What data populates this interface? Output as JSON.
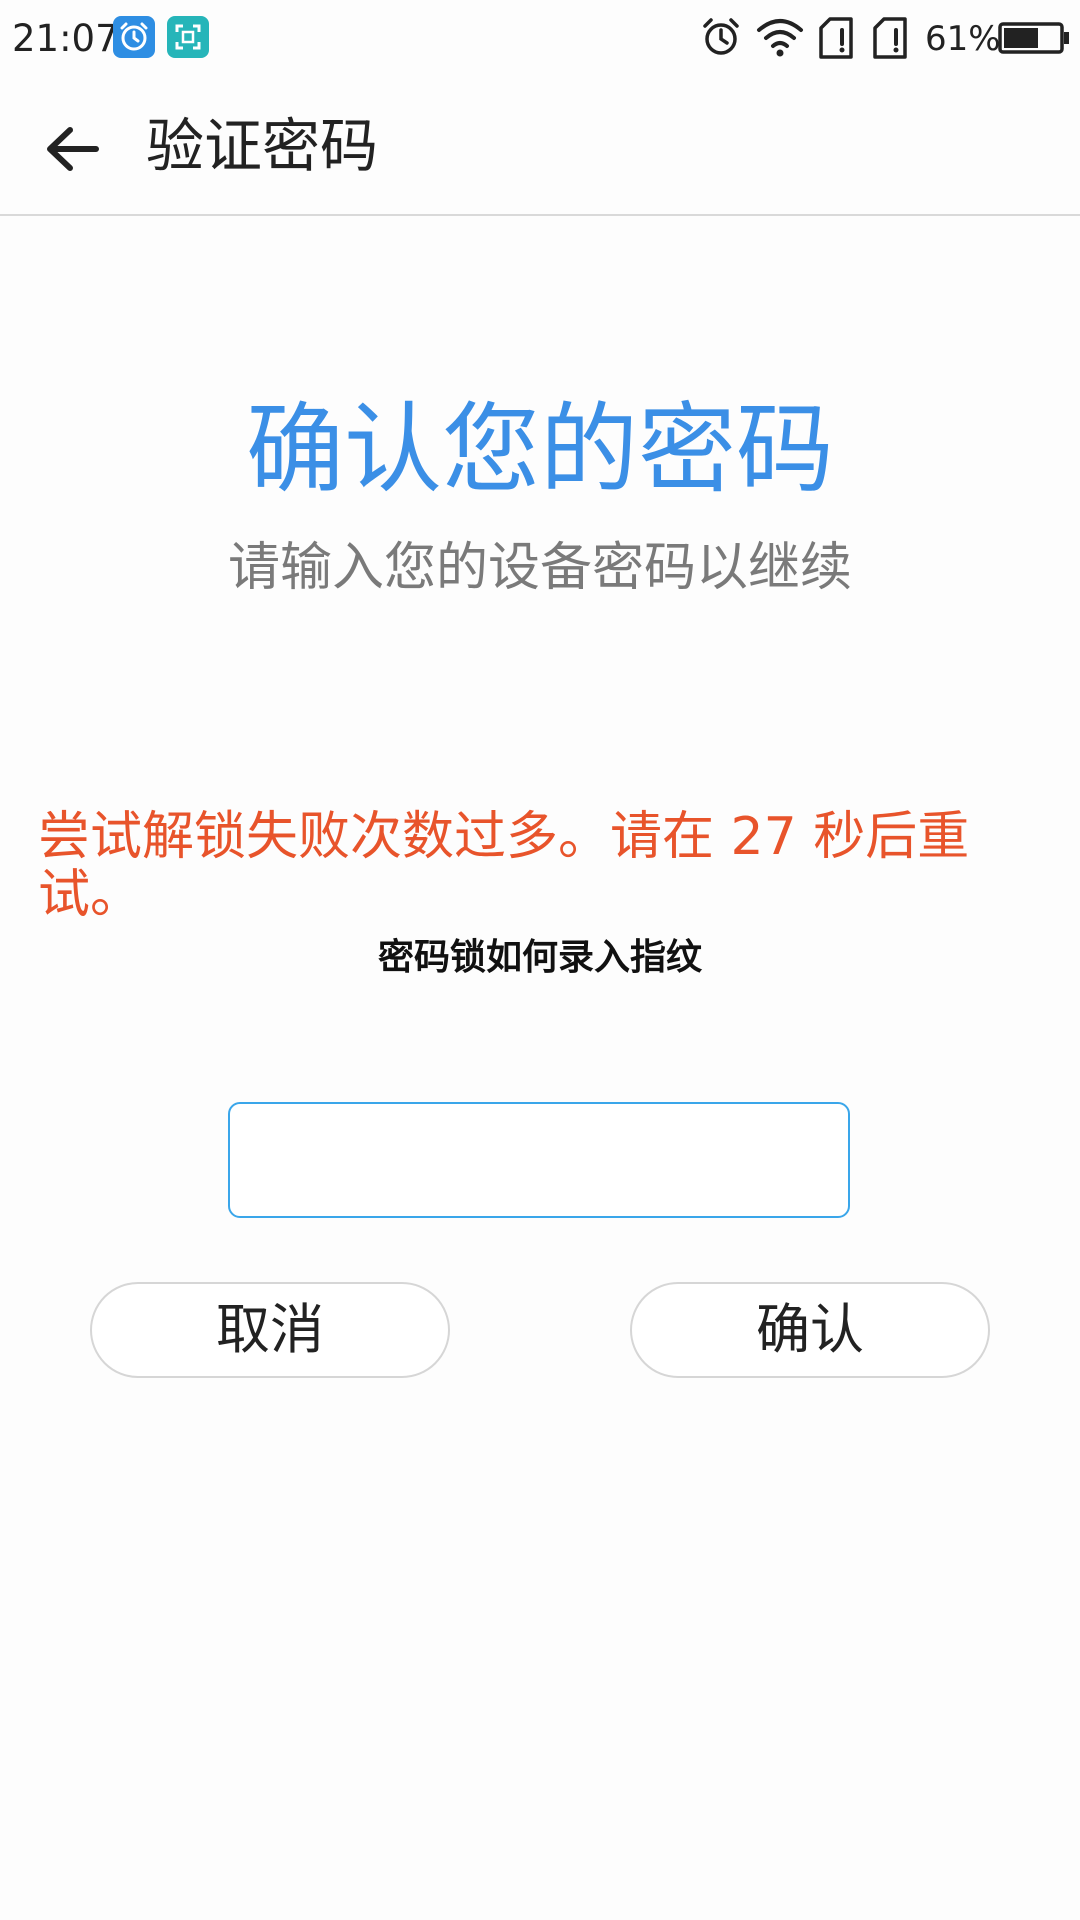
{
  "status_bar": {
    "time": "21:07",
    "notification_icons": [
      "alarm-app-icon",
      "scan-app-icon"
    ],
    "system_icons": [
      "alarm-icon",
      "wifi-icon",
      "sim-1-alert-icon",
      "sim-2-alert-icon"
    ],
    "battery_percent": "61%",
    "battery_level": 0.61
  },
  "toolbar": {
    "back_icon": "arrow-left-icon",
    "title": "验证密码"
  },
  "main": {
    "headline": "确认您的密码",
    "subtitle": "请输入您的设备密码以继续",
    "error_message": "尝试解锁失败次数过多。请在 27 秒后重试。",
    "watermark": "密码锁如何录入指纹",
    "password_input": {
      "value": "",
      "placeholder": ""
    },
    "cancel_label": "取消",
    "confirm_label": "确认"
  },
  "colors": {
    "accent": "#3b8fe6",
    "error": "#e8542b",
    "input_border": "#3aa6ea",
    "subtitle": "#7a7a7a"
  }
}
